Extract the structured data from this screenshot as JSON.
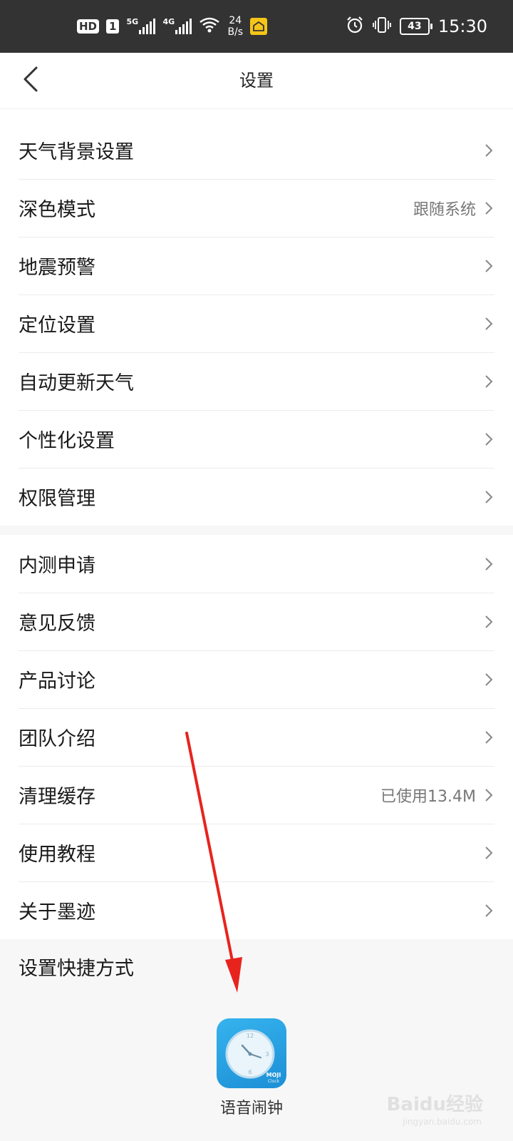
{
  "status_bar": {
    "hd": "HD",
    "sim": "1",
    "signal1_gen": "5G",
    "signal2_gen": "4G",
    "speed_value": "24",
    "speed_unit": "B/s",
    "battery": "43",
    "time": "15:30"
  },
  "header": {
    "title": "设置"
  },
  "group1": [
    {
      "label": "天气背景设置",
      "value": ""
    },
    {
      "label": "深色模式",
      "value": "跟随系统"
    },
    {
      "label": "地震预警",
      "value": ""
    },
    {
      "label": "定位设置",
      "value": ""
    },
    {
      "label": "自动更新天气",
      "value": ""
    },
    {
      "label": "个性化设置",
      "value": ""
    },
    {
      "label": "权限管理",
      "value": ""
    }
  ],
  "group2": [
    {
      "label": "内测申请",
      "value": ""
    },
    {
      "label": "意见反馈",
      "value": ""
    },
    {
      "label": "产品讨论",
      "value": ""
    },
    {
      "label": "团队介绍",
      "value": ""
    },
    {
      "label": "清理缓存",
      "value": "已使用13.4M"
    },
    {
      "label": "使用教程",
      "value": ""
    },
    {
      "label": "关于墨迹",
      "value": ""
    }
  ],
  "shortcut": {
    "title": "设置快捷方式",
    "app_label": "语音闹钟",
    "app_brand": "MOJI",
    "app_brand_sub": "Clock"
  },
  "watermark": {
    "main": "Baidu经验",
    "sub": "jingyan.baidu.com"
  },
  "colors": {
    "status_bar_bg": "#333333",
    "annotation_arrow": "#e8231e",
    "app_icon": "#1c8fd6"
  }
}
